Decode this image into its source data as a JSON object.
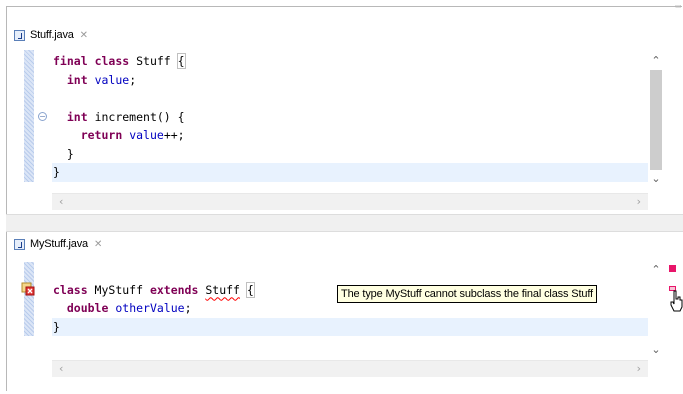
{
  "editor1": {
    "tab_title": "Stuff.java",
    "tab_close": "✕",
    "lines": [
      {
        "indent": "",
        "tokens": [
          [
            "kw",
            "final"
          ],
          [
            "t",
            " "
          ],
          [
            "kw",
            "class"
          ],
          [
            "t",
            " Stuff "
          ],
          [
            "box",
            "{"
          ]
        ]
      },
      {
        "indent": "  ",
        "tokens": [
          [
            "kw",
            "int"
          ],
          [
            "t",
            " "
          ],
          [
            "fld",
            "value"
          ],
          [
            "t",
            ";"
          ]
        ]
      },
      {
        "indent": "",
        "tokens": []
      },
      {
        "indent": "  ",
        "tokens": [
          [
            "kw",
            "int"
          ],
          [
            "t",
            " increment() {"
          ]
        ]
      },
      {
        "indent": "    ",
        "tokens": [
          [
            "kw",
            "return"
          ],
          [
            "t",
            " "
          ],
          [
            "fld",
            "value"
          ],
          [
            "t",
            "++;"
          ]
        ]
      },
      {
        "indent": "  ",
        "tokens": [
          [
            "t",
            "}"
          ]
        ]
      },
      {
        "indent": "",
        "tokens": [
          [
            "t",
            "}"
          ]
        ],
        "highlight": true
      }
    ]
  },
  "editor2": {
    "tab_title": "MyStuff.java",
    "tab_close": "✕",
    "lines": [
      {
        "indent": "",
        "tokens": []
      },
      {
        "indent": "",
        "tokens": [
          [
            "kw",
            "class"
          ],
          [
            "t",
            " MyStuff "
          ],
          [
            "kw",
            "extends"
          ],
          [
            "t",
            " "
          ],
          [
            "sq",
            "Stuff"
          ],
          [
            "t",
            " "
          ],
          [
            "box",
            "{"
          ]
        ]
      },
      {
        "indent": "  ",
        "tokens": [
          [
            "kw",
            "double"
          ],
          [
            "t",
            " "
          ],
          [
            "fld",
            "otherValue"
          ],
          [
            "t",
            ";"
          ]
        ]
      },
      {
        "indent": "",
        "tokens": [
          [
            "t",
            "}"
          ]
        ],
        "highlight": true
      }
    ]
  },
  "tooltip": {
    "text": "The type MyStuff cannot subclass the final class Stuff"
  },
  "icons": {
    "fold": "fold-collapse-icon",
    "error": "error-marker-icon",
    "java_file": "java-file-icon",
    "cursor": "hand-cursor-icon"
  },
  "colors": {
    "keyword": "#7f0055",
    "field": "#0000c0",
    "current_line": "#e8f2fe",
    "tooltip_bg": "#ffffe1",
    "error_mark": "#e8156a"
  }
}
